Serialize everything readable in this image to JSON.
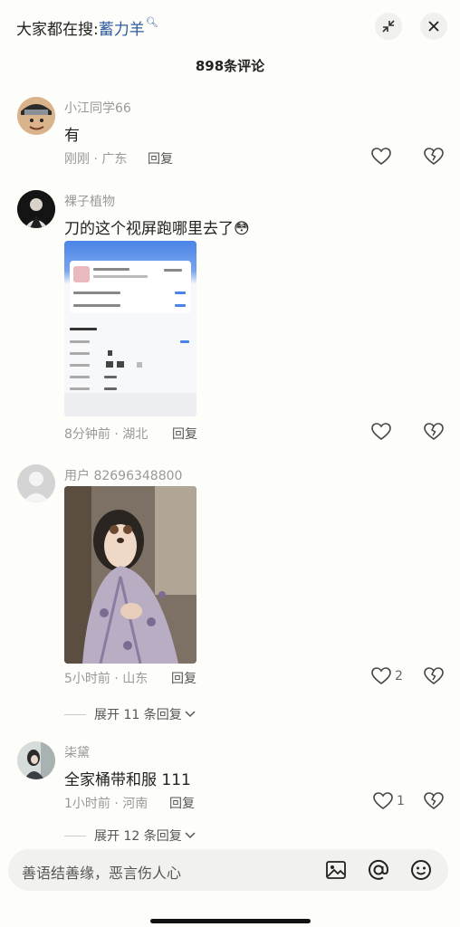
{
  "header": {
    "search_prefix": "大家都在搜:",
    "search_term": "蓄力羊",
    "comment_count": "898条评论"
  },
  "comments": [
    {
      "username": "小江同学66",
      "text": "有",
      "meta": "刚刚 · 广东",
      "reply": "回复",
      "likes": ""
    },
    {
      "username": "裸子植物",
      "text": "刀的这个视屏跑哪里去了😳",
      "meta": "8分钟前 · 湖北",
      "reply": "回复",
      "likes": ""
    },
    {
      "username": "用户 82696348800",
      "meta": "5小时前 · 山东",
      "reply": "回复",
      "likes": "2",
      "expand": "展开 11 条回复"
    },
    {
      "username": "柒黛",
      "text": "全家桶带和服 111",
      "meta": "1小时前 · 河南",
      "reply": "回复",
      "likes": "1",
      "expand": "展开 12 条回复"
    }
  ],
  "input": {
    "placeholder": "善语结善缘，恶言伤人心"
  },
  "icons": {
    "collapse": "collapse-icon",
    "close": "close-icon",
    "like": "heart-icon",
    "dislike": "broken-heart-icon",
    "image": "image-icon",
    "mention": "at-icon",
    "emoji": "emoji-icon",
    "expand": "chevron-down-icon"
  }
}
